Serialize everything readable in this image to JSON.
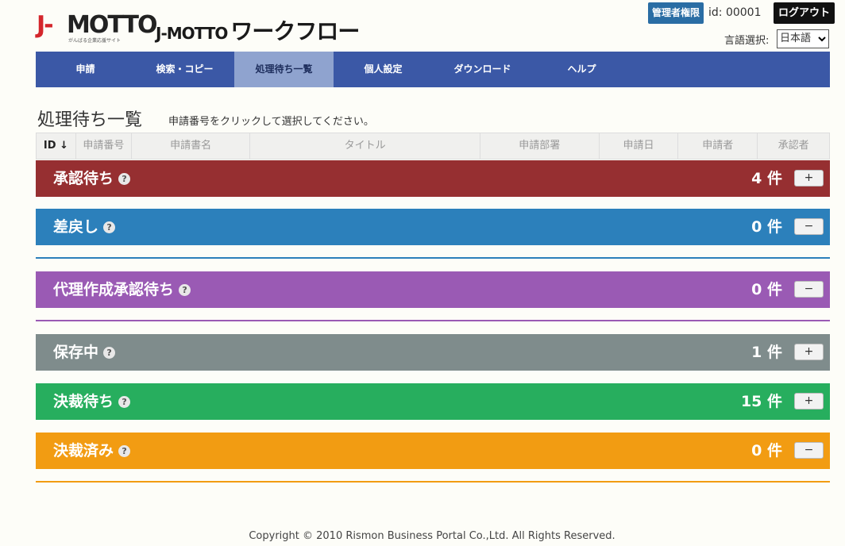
{
  "header": {
    "logo_text_j": "J-",
    "logo_text_m": "MOTTO",
    "logo_tagline": "がんばる企業応援サイト",
    "brand_prefix": "J-MOTTO",
    "brand_suffix": "ワークフロー",
    "admin_badge": "管理者権限",
    "user_id": "id: 00001",
    "logout_label": "ログアウト",
    "language_label": "言語選択:",
    "language_value": "日本語"
  },
  "nav": {
    "items": [
      {
        "label": "申請"
      },
      {
        "label": "検索・コピー"
      },
      {
        "label": "処理待ち一覧"
      },
      {
        "label": "個人設定"
      },
      {
        "label": "ダウンロード"
      },
      {
        "label": "ヘルプ"
      }
    ],
    "active_index": 2
  },
  "page": {
    "title": "処理待ち一覧",
    "subtitle": "申請番号をクリックして選択してください。"
  },
  "table": {
    "columns": [
      {
        "label": "ID ↓"
      },
      {
        "label": "申請番号"
      },
      {
        "label": "申請書名"
      },
      {
        "label": "タイトル"
      },
      {
        "label": "申請部署"
      },
      {
        "label": "申請日"
      },
      {
        "label": "申請者"
      },
      {
        "label": "承認者"
      }
    ]
  },
  "sections": [
    {
      "name": "承認待ち",
      "count": "4 件",
      "toggle": "+",
      "color": "#962f31"
    },
    {
      "name": "差戻し",
      "count": "0 件",
      "toggle": "−",
      "color": "#2c80bb"
    },
    {
      "name": "代理作成承認待ち",
      "count": "0 件",
      "toggle": "−",
      "color": "#9a5ab4"
    },
    {
      "name": "保存中",
      "count": "1 件",
      "toggle": "+",
      "color": "#7f8c8c"
    },
    {
      "name": "決裁待ち",
      "count": "15 件",
      "toggle": "+",
      "color": "#27ae5e"
    },
    {
      "name": "決裁済み",
      "count": "0 件",
      "toggle": "−",
      "color": "#f29c12"
    }
  ],
  "footer": {
    "copyright": "Copyright © 2010 Rismon Business Portal Co.,Ltd. All Rights Reserved."
  }
}
